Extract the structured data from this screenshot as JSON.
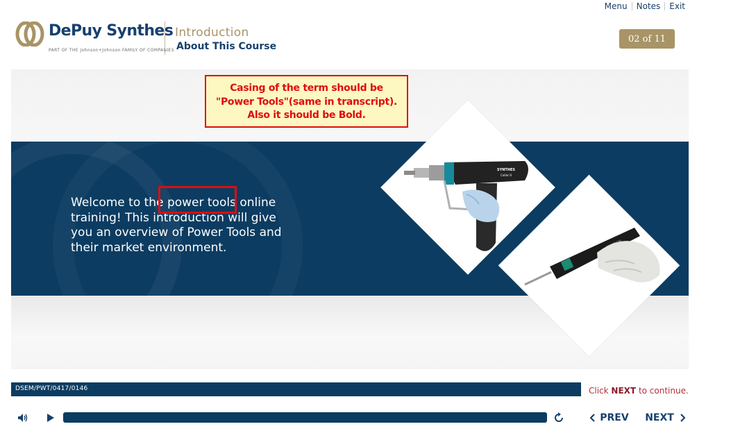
{
  "top_nav": {
    "menu": "Menu",
    "notes": "Notes",
    "exit": "Exit"
  },
  "brand": {
    "name": "DePuy Synthes",
    "tagline": "PART OF THE Johnson+Johnson FAMILY OF COMPANIES",
    "color": "#17416e",
    "accent": "#a8946a"
  },
  "header": {
    "section": "Introduction",
    "subtitle": "About This Course",
    "page_counter": "02 of 11"
  },
  "annotation": {
    "line1": "Casing of the term should be",
    "line2": "\"Power Tools\"(same in transcript).",
    "line3": "Also it should be Bold."
  },
  "content": {
    "welcome_text": "Welcome to the power tools online training! This introduction will give you an overview of Power Tools and their market environment."
  },
  "images": {
    "drill_brand": "SYNTHES",
    "drill_model": "Colibri II",
    "handpiece_brand": "ANSPACH"
  },
  "footer": {
    "code": "DSEM/PWT/0417/0146",
    "continue_prefix": "Click",
    "continue_next": "NEXT",
    "continue_suffix": "to continue.",
    "prev_label": "PREV",
    "next_label": "NEXT"
  },
  "player": {
    "progress": 0.0
  },
  "colors": {
    "navy": "#0c3c61",
    "annotation_red": "#e00d0d",
    "annotation_bg": "#fdf7c2",
    "gold": "#a89466"
  }
}
